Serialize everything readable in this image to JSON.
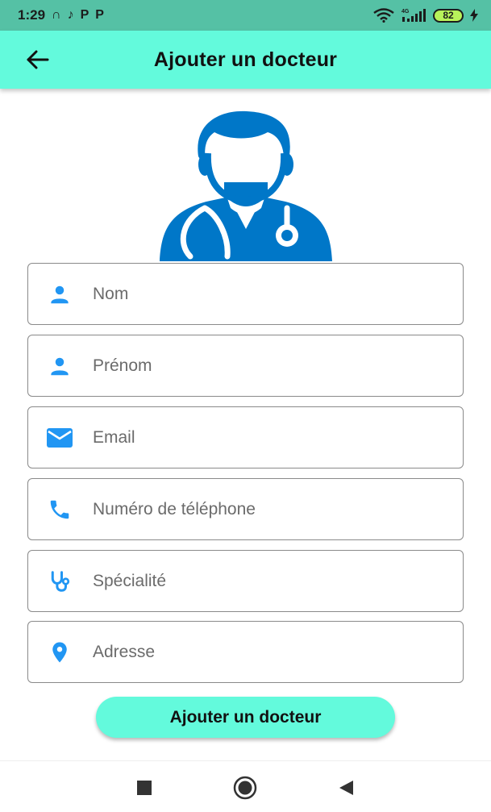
{
  "status_bar": {
    "time": "1:29",
    "notification_icons": [
      "headphones-icon",
      "tiktok-icon",
      "p-app-icon",
      "p-app-icon"
    ],
    "notification_glyphs": [
      "∩",
      "♪",
      "P",
      "P"
    ],
    "network": "4G",
    "battery": "82"
  },
  "app_bar": {
    "title": "Ajouter un docteur",
    "background": "#63fadc"
  },
  "form": {
    "fields": [
      {
        "placeholder": "Nom",
        "icon": "person-icon"
      },
      {
        "placeholder": "Prénom",
        "icon": "person-icon"
      },
      {
        "placeholder": "Email",
        "icon": "email-icon"
      },
      {
        "placeholder": "Numéro de téléphone",
        "icon": "phone-icon"
      },
      {
        "placeholder": "Spécialité",
        "icon": "stethoscope-icon"
      },
      {
        "placeholder": "Adresse",
        "icon": "location-pin-icon"
      }
    ],
    "icon_color": "#2196f3"
  },
  "submit_button": {
    "label": "Ajouter un docteur"
  },
  "colors": {
    "accent": "#63fadc",
    "status_bar": "#55c1a5",
    "avatar": "#0077c8"
  }
}
